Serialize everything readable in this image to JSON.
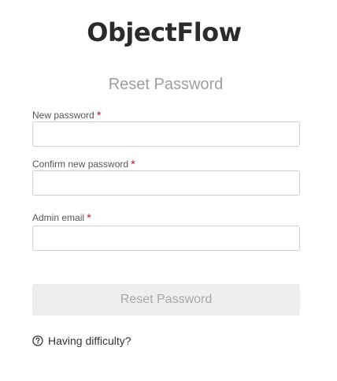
{
  "brand": {
    "logo_text": "ObjectFlow"
  },
  "form": {
    "title": "Reset Password",
    "required_marker": "*",
    "fields": {
      "new_password": {
        "label": "New password",
        "value": "",
        "placeholder": ""
      },
      "confirm_password": {
        "label": "Confirm new password",
        "value": "",
        "placeholder": ""
      },
      "admin_email": {
        "label": "Admin email",
        "value": "",
        "placeholder": ""
      }
    },
    "submit_label": "Reset Password"
  },
  "help": {
    "icon": "question-circle-icon",
    "label": "Having difficulty?"
  },
  "colors": {
    "required": "#d0202f",
    "title": "#9e9e9e",
    "button_bg_disabled": "#eeeeee",
    "button_text_disabled": "#a8a8a8",
    "input_border": "#cfcfcf"
  }
}
